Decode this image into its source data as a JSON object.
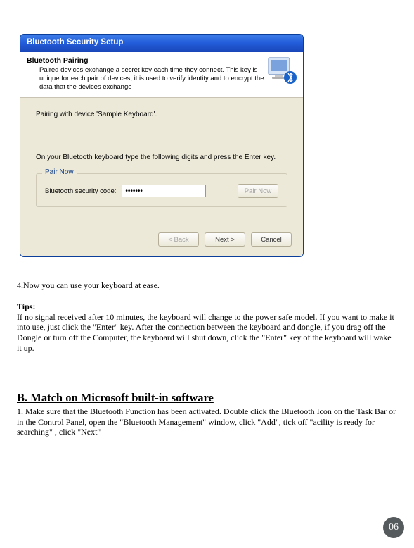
{
  "dialog": {
    "title": "Bluetooth Security Setup",
    "header": {
      "title": "Bluetooth Pairing",
      "desc": "Paired devices exchange a secret key each time they connect. This key is unique for each pair of devices; it is used to verify identity and to encrypt the data that the devices exchange"
    },
    "pairing_text": "Pairing with device 'Sample Keyboard'.",
    "instruction_text": "On your Bluetooth keyboard type the following digits and press the Enter key.",
    "fieldset_legend": "Pair Now",
    "code_label": "Bluetooth security code:",
    "code_value": "•••••••",
    "pairnow_btn": "Pair Now",
    "back_btn": "< Back",
    "next_btn": "Next >",
    "cancel_btn": "Cancel"
  },
  "doc": {
    "step4": "4.Now you can use your keyboard at ease.",
    "tips_label": "Tips:",
    "tips_body": "If no signal received after 10 minutes, the keyboard will change to the power safe model. If you want to make it into use, just click the \"Enter\" key. After the connection between the keyboard and dongle, if you drag off the Dongle or turn off the Computer, the keyboard will shut down,  click the \"Enter\" key of the keyboard will wake it up.",
    "section_b_title": "B. Match on Microsoft built-in software",
    "section_b_body": "1. Make sure that the Bluetooth Function has been activated. Double click the Bluetooth Icon on the Task Bar or in the Control Panel, open the \"Bluetooth Management\" window, click \"Add\", tick off \"acility is ready for searching\" , click \"Next\"",
    "page_number": "06"
  }
}
